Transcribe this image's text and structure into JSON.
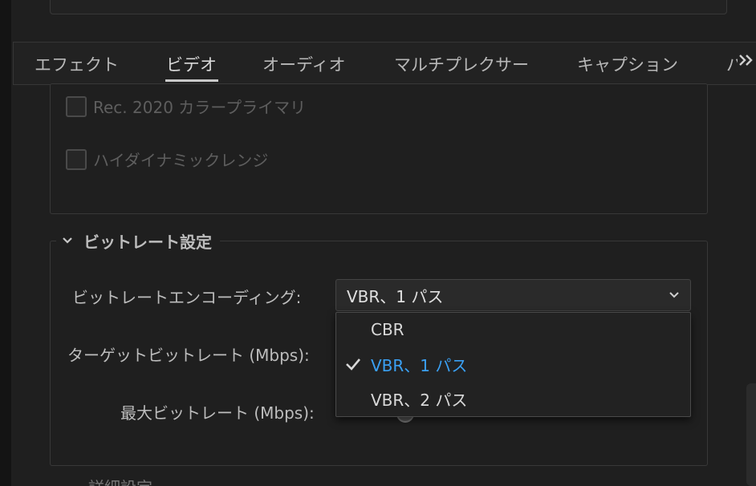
{
  "tabs": [
    {
      "label": "エフェクト",
      "active": false
    },
    {
      "label": "ビデオ",
      "active": true
    },
    {
      "label": "オーディオ",
      "active": false
    },
    {
      "label": "マルチプレクサー",
      "active": false
    },
    {
      "label": "キャプション",
      "active": false
    },
    {
      "label": "パ",
      "active": false
    }
  ],
  "tab_overflow_icon": "double-chevron-right-icon",
  "color_options": {
    "rec2020_label": "Rec. 2020 カラープライマリ",
    "rec2020_checked": false,
    "hdr_label": "ハイダイナミックレンジ",
    "hdr_checked": false
  },
  "bitrate_section": {
    "title": "ビットレート設定",
    "expanded": true,
    "encoding_label": "ビットレートエンコーディング:",
    "encoding_value": "VBR、1 パス",
    "target_label": "ターゲットビットレート (Mbps):",
    "max_label": "最大ビットレート (Mbps):"
  },
  "encoding_dropdown": {
    "options": [
      {
        "label": "CBR",
        "selected": false
      },
      {
        "label": "VBR、1 パス",
        "selected": true
      },
      {
        "label": "VBR、2 パス",
        "selected": false
      }
    ]
  },
  "next_section_partial": "詳細設定",
  "colors": {
    "selected_option": "#3aa0f3",
    "background": "#1f1f1f",
    "panel_border": "#383838"
  }
}
